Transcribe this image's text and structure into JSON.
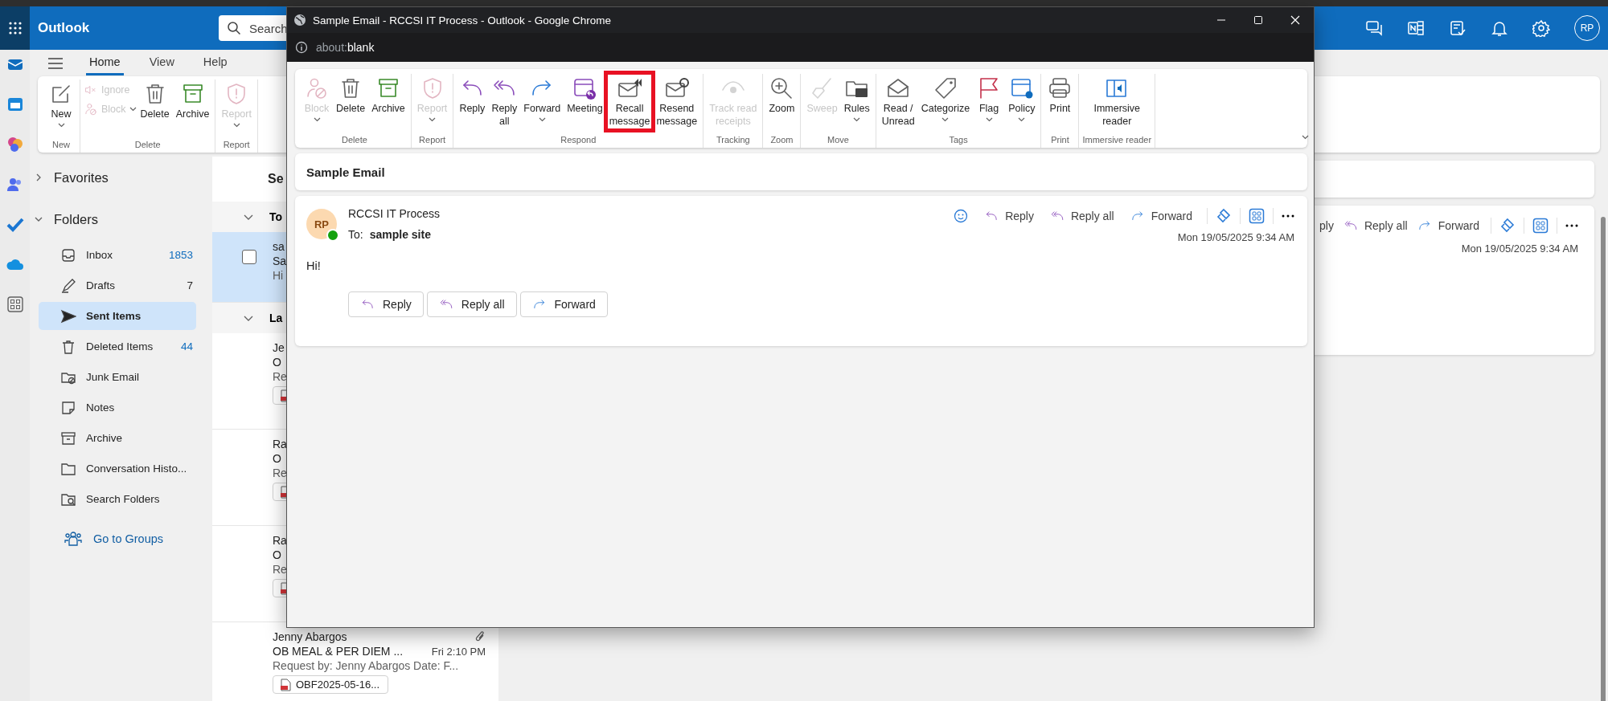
{
  "outlook": {
    "app_name": "Outlook",
    "search": {
      "placeholder": "Search"
    },
    "avatar": "RP",
    "menu_tabs": [
      {
        "label": "Home",
        "selected": true
      },
      {
        "label": "View",
        "selected": false
      },
      {
        "label": "Help",
        "selected": false
      }
    ],
    "ribbon_groups": [
      {
        "label": "New",
        "buttons": [
          {
            "kind": "new",
            "label_lines": [
              "New"
            ],
            "dropdown": true,
            "disabled": false
          }
        ]
      },
      {
        "label": "Delete",
        "small_buttons": [
          {
            "kind": "ignore",
            "label": "Ignore",
            "dropdown": false,
            "disabled": true
          },
          {
            "kind": "block",
            "label": "Block",
            "dropdown": true,
            "disabled": true
          }
        ],
        "buttons": [
          {
            "kind": "delete",
            "label_lines": [
              "Delete"
            ],
            "dropdown": false,
            "disabled": false
          },
          {
            "kind": "archive",
            "label_lines": [
              "Archive"
            ],
            "dropdown": false,
            "disabled": false
          }
        ]
      },
      {
        "label": "Report",
        "buttons": [
          {
            "kind": "report",
            "label_lines": [
              "Report"
            ],
            "dropdown": true,
            "disabled": true
          }
        ]
      }
    ],
    "folder_pane": {
      "sections": [
        {
          "label": "Favorites",
          "expanded": false
        },
        {
          "label": "Folders",
          "expanded": true
        }
      ],
      "folders": [
        {
          "kind": "inbox",
          "label": "Inbox",
          "count": "1853",
          "selected": false
        },
        {
          "kind": "drafts",
          "label": "Drafts",
          "count": "7",
          "selected": false
        },
        {
          "kind": "sent",
          "label": "Sent Items",
          "selected": true
        },
        {
          "kind": "deleted",
          "label": "Deleted Items",
          "count": "44",
          "selected": false
        },
        {
          "kind": "junk",
          "label": "Junk Email",
          "selected": false
        },
        {
          "kind": "notes",
          "label": "Notes",
          "selected": false
        },
        {
          "kind": "archive",
          "label": "Archive",
          "selected": false
        },
        {
          "kind": "folder",
          "label": "Conversation Histo...",
          "selected": false
        },
        {
          "kind": "search",
          "label": "Search Folders",
          "selected": false
        }
      ],
      "groups_link": "Go to Groups"
    },
    "message_list": {
      "header": "Se",
      "sections": [
        {
          "label": "To",
          "expanded": true,
          "messages": [
            {
              "sender": "sa",
              "subject": "Sa",
              "preview": "Hi",
              "selected": true,
              "has_attachment": false
            }
          ]
        },
        {
          "label": "La",
          "expanded": true,
          "messages": [
            {
              "sender": "Je",
              "subject": "O",
              "preview": "Re",
              "selected": false,
              "has_attachment": true
            },
            {
              "sender": "Ra",
              "subject": "O",
              "preview": "Re",
              "selected": false,
              "has_attachment": true
            },
            {
              "sender": "Ra",
              "subject": "O",
              "preview": "Re",
              "selected": false,
              "has_attachment": true
            },
            {
              "sender": "Jenny Abargos",
              "subject": "OB MEAL & PER DIEM ...",
              "time": "Fri 2:10 PM",
              "preview": "Request by: Jenny Abargos Date: F...",
              "selected": false,
              "has_attachment": true,
              "attachment_name": "OBF2025-05-16..."
            }
          ]
        }
      ]
    },
    "reading_pane": {
      "actions": [
        {
          "kind": "cut-off",
          "label": "ply"
        },
        {
          "kind": "reply-all",
          "label": "Reply all"
        },
        {
          "kind": "forward",
          "label": "Forward"
        }
      ],
      "date": "Mon 19/05/2025 9:34 AM"
    }
  },
  "popup": {
    "title": "Sample Email - RCCSI IT Process - Outlook - Google Chrome",
    "url": {
      "scheme": "about:",
      "path": "blank"
    },
    "ribbon_groups": [
      {
        "label": "Delete",
        "buttons": [
          {
            "kind": "block",
            "label_lines": [
              "Block"
            ],
            "dropdown": true,
            "disabled": true
          },
          {
            "kind": "delete",
            "label_lines": [
              "Delete"
            ],
            "dropdown": false,
            "disabled": false
          },
          {
            "kind": "archive",
            "label_lines": [
              "Archive"
            ],
            "dropdown": false,
            "disabled": false
          }
        ]
      },
      {
        "label": "Report",
        "buttons": [
          {
            "kind": "report",
            "label_lines": [
              "Report"
            ],
            "dropdown": true,
            "disabled": true
          }
        ]
      },
      {
        "label": "Respond",
        "buttons": [
          {
            "kind": "reply",
            "label_lines": [
              "Reply"
            ],
            "dropdown": false,
            "disabled": false
          },
          {
            "kind": "reply-all",
            "label_lines": [
              "Reply",
              "all"
            ],
            "dropdown": false,
            "disabled": false
          },
          {
            "kind": "forward",
            "label_lines": [
              "Forward"
            ],
            "dropdown": true,
            "disabled": false
          },
          {
            "kind": "meeting",
            "label_lines": [
              "Meeting"
            ],
            "dropdown": false,
            "disabled": false
          },
          {
            "kind": "recall",
            "label_lines": [
              "Recall",
              "message"
            ],
            "dropdown": false,
            "disabled": false,
            "highlighted": true
          },
          {
            "kind": "resend",
            "label_lines": [
              "Resend",
              "message"
            ],
            "dropdown": false,
            "disabled": false
          }
        ]
      },
      {
        "label": "Tracking",
        "buttons": [
          {
            "kind": "track",
            "label_lines": [
              "Track read",
              "receipts"
            ],
            "dropdown": false,
            "disabled": true
          }
        ]
      },
      {
        "label": "Zoom",
        "buttons": [
          {
            "kind": "zoom",
            "label_lines": [
              "Zoom"
            ],
            "dropdown": false,
            "disabled": false
          }
        ]
      },
      {
        "label": "Move",
        "buttons": [
          {
            "kind": "sweep",
            "label_lines": [
              "Sweep"
            ],
            "dropdown": false,
            "disabled": true
          },
          {
            "kind": "rules",
            "label_lines": [
              "Rules"
            ],
            "dropdown": true,
            "disabled": false
          }
        ]
      },
      {
        "label": "Tags",
        "buttons": [
          {
            "kind": "read",
            "label_lines": [
              "Read /",
              "Unread"
            ],
            "dropdown": false,
            "disabled": false
          },
          {
            "kind": "categorize",
            "label_lines": [
              "Categorize"
            ],
            "dropdown": true,
            "disabled": false
          },
          {
            "kind": "flag",
            "label_lines": [
              "Flag"
            ],
            "dropdown": true,
            "disabled": false
          },
          {
            "kind": "policy",
            "label_lines": [
              "Policy"
            ],
            "dropdown": true,
            "disabled": false
          }
        ]
      },
      {
        "label": "Print",
        "buttons": [
          {
            "kind": "print",
            "label_lines": [
              "Print"
            ],
            "dropdown": false,
            "disabled": false
          }
        ]
      },
      {
        "label": "Immersive reader",
        "buttons": [
          {
            "kind": "immersive",
            "label_lines": [
              "Immersive",
              "reader"
            ],
            "dropdown": false,
            "disabled": false
          }
        ]
      }
    ],
    "subject": "Sample Email",
    "message": {
      "avatar": "RP",
      "online": true,
      "sender": "RCCSI IT Process",
      "to_label": "To:",
      "recipient": "sample site",
      "date": "Mon 19/05/2025 9:34 AM",
      "body": "Hi!",
      "actions": [
        {
          "kind": "reply",
          "label": "Reply"
        },
        {
          "kind": "reply-all",
          "label": "Reply all"
        },
        {
          "kind": "forward",
          "label": "Forward"
        }
      ],
      "reply_buttons": [
        {
          "kind": "reply",
          "label": "Reply"
        },
        {
          "kind": "reply-all",
          "label": "Reply all"
        },
        {
          "kind": "forward",
          "label": "Forward"
        }
      ]
    }
  }
}
